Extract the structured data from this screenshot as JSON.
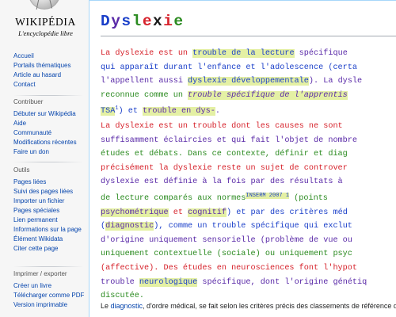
{
  "logo": {
    "wordmark": "WIKIPÉDIA",
    "tagline": "L'encyclopédie libre"
  },
  "sidebar": {
    "nav": [
      "Accueil",
      "Portails thématiques",
      "Article au hasard",
      "Contact"
    ],
    "contribuer": {
      "heading": "Contribuer",
      "items": [
        "Débuter sur Wikipédia",
        "Aide",
        "Communauté",
        "Modifications récentes",
        "Faire un don"
      ]
    },
    "outils": {
      "heading": "Outils",
      "items": [
        "Pages liées",
        "Suivi des pages liées",
        "Importer un fichier",
        "Pages spéciales",
        "Lien permanent",
        "Informations sur la page",
        "Élément Wikidata",
        "Citer cette page"
      ]
    },
    "imprimer": {
      "heading": "Imprimer / exporter",
      "items": [
        "Créer un livre",
        "Télécharger comme PDF",
        "Version imprimable"
      ]
    }
  },
  "article": {
    "title_letters": [
      "D",
      "y",
      "s",
      "l",
      "e",
      "x",
      "i",
      "e"
    ],
    "title_colors": [
      "#1a3fc9",
      "#5a2aa8",
      "#1a3fc9",
      "#2a8a1f",
      "#d6222b",
      "#1a1a1a",
      "#d6222b",
      "#2a8a1f"
    ],
    "p1": {
      "l1_a": "La dyslexie est un ",
      "l1_b": "trouble de la lecture",
      "l1_c": " spécifique",
      "l2": "qui apparaît durant l'enfance et l'adolescence (certa",
      "l3_a": "l'appellent aussi ",
      "l3_b": "dyslexie développementale",
      "l3_c": "). La dysle",
      "l4_a": "reconnue comme un ",
      "l4_b": "trouble spécifique de l'apprentis",
      "l5_a": "TSA",
      "l5_sup": "1",
      "l5_b": ") et ",
      "l5_c": "trouble en dys-",
      "l5_d": "."
    },
    "p2": {
      "l1": "La dyslexie est un trouble dont les causes ne sont",
      "l2": "suffisamment éclaircies et qui fait l'objet de nombre",
      "l3": "études et débats. Dans ce contexte, définir et diag",
      "l4": "précisément la dyslexie reste un sujet de controver",
      "l5": "dyslexie est définie à la fois par des résultats à",
      "l6_a": "de lecture comparés aux normes",
      "l6_badge": "INSERM 2007 1",
      "l6_b": " (points",
      "l7_a": "psychométrique",
      "l7_b": " et ",
      "l7_c": "cognitif",
      "l7_d": ") et par des critères méd",
      "l8_a": "(",
      "l8_b": "diagnostic",
      "l8_c": "), comme un trouble spécifique qui exclut",
      "l9": "d'origine uniquement sensorielle (problème de vue ou",
      "l10": "uniquement contextuelle (sociale) ou uniquement psyc",
      "l11": "(affective). Des études en neurosciences font l'hypot",
      "l12_a": "trouble ",
      "l12_b": "neurologique",
      "l12_c": " spécifique, dont l'origine génétiq",
      "l13": "discutée."
    },
    "p3": {
      "a": "Le ",
      "link": "diagnostic",
      "b": ", d'ordre médical, se fait selon les critères précis des classements de référence qu"
    }
  }
}
